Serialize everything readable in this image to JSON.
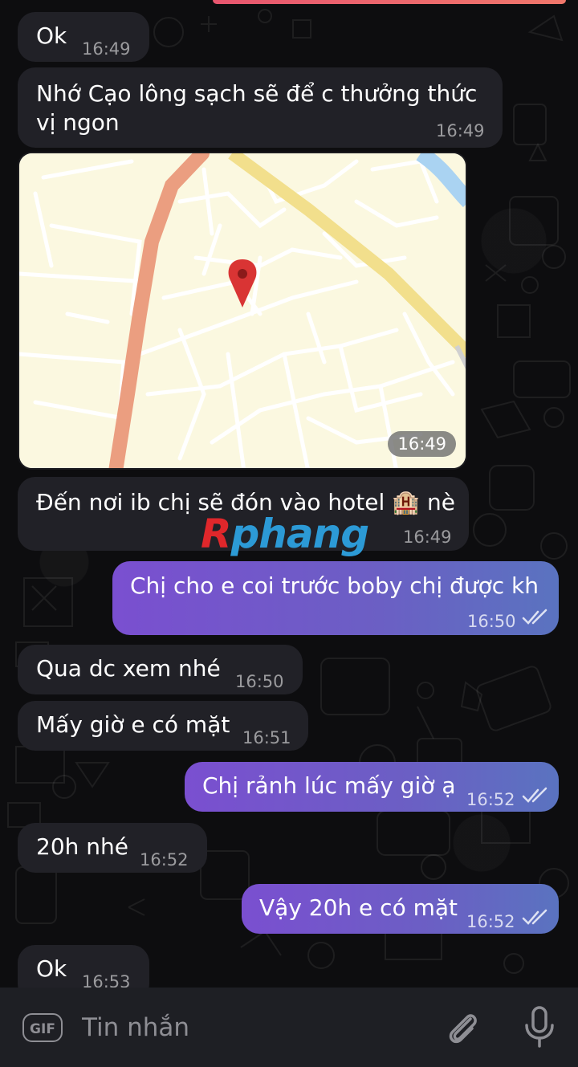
{
  "messages": [
    {
      "text": "Ok",
      "time": "16:49"
    },
    {
      "text": "Nhớ Cạo lông sạch sẽ để c thưởng thức\nvị ngon",
      "time": "16:49"
    },
    {
      "map_time": "16:49"
    },
    {
      "text": "Đến nơi ib chị sẽ đón vào hotel 🏨 nè",
      "time": "16:49"
    },
    {
      "text": "Chị cho e coi trước boby chị được kh",
      "time": "16:50"
    },
    {
      "text": "Qua dc xem nhé",
      "time": "16:50"
    },
    {
      "text": "Mấy giờ e có mặt",
      "time": "16:51"
    },
    {
      "text": "Chị rảnh lúc mấy giờ ạ",
      "time": "16:52"
    },
    {
      "text": "20h nhé",
      "time": "16:52"
    },
    {
      "text": "Vậy 20h e có mặt",
      "time": "16:52"
    },
    {
      "text": "Ok",
      "time": "16:53"
    }
  ],
  "watermark": {
    "first": "R",
    "rest": "phang"
  },
  "input": {
    "placeholder": "Tin nhắn",
    "gif_label": "GIF"
  },
  "icons": {
    "gif": "gif-icon",
    "attach": "paperclip-icon",
    "mic": "microphone-icon",
    "map_pin": "map-pin-icon",
    "read": "double-check-icon"
  },
  "colors": {
    "incoming_bubble": "#212127",
    "outgoing_gradient_start": "#7a4fd0",
    "outgoing_gradient_end": "#5a73c0",
    "map_pin": "#d93434"
  }
}
